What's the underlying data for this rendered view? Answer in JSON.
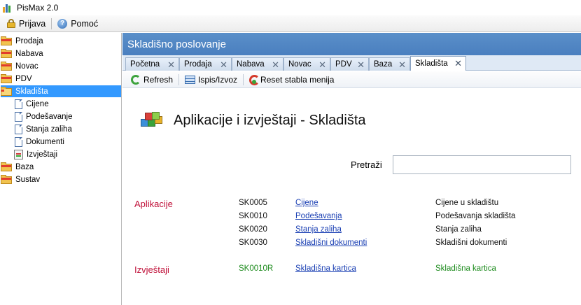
{
  "window": {
    "title": "PisMax 2.0"
  },
  "menubar": {
    "items": [
      {
        "label": "Prijava",
        "icon": "lock-icon"
      },
      {
        "label": "Pomoć",
        "icon": "help-icon"
      }
    ]
  },
  "sidebar": {
    "items": [
      {
        "label": "Prodaja",
        "icon": "folder-icon"
      },
      {
        "label": "Nabava",
        "icon": "folder-icon"
      },
      {
        "label": "Novac",
        "icon": "folder-icon"
      },
      {
        "label": "PDV",
        "icon": "folder-icon"
      },
      {
        "label": "Skladišta",
        "icon": "folder-open-icon",
        "selected": true
      },
      {
        "label": "Cijene",
        "icon": "document-icon"
      },
      {
        "label": "Podešavanje",
        "icon": "document-icon"
      },
      {
        "label": "Stanja zaliha",
        "icon": "document-icon"
      },
      {
        "label": "Dokumenti",
        "icon": "document-icon"
      },
      {
        "label": "Izvještaji",
        "icon": "report-icon"
      },
      {
        "label": "Baza",
        "icon": "folder-icon"
      },
      {
        "label": "Sustav",
        "icon": "folder-icon"
      }
    ]
  },
  "main": {
    "header": "Skladišno poslovanje",
    "tabs": [
      {
        "label": "Početna"
      },
      {
        "label": "Prodaja"
      },
      {
        "label": "Nabava"
      },
      {
        "label": "Novac"
      },
      {
        "label": "PDV"
      },
      {
        "label": "Baza"
      },
      {
        "label": "Skladišta",
        "active": true
      }
    ],
    "close_glyph": "✕"
  },
  "toolbar": {
    "refresh_label": "Refresh",
    "print_label": "Ispis/Izvoz",
    "reset_label": "Reset stabla menija"
  },
  "content": {
    "title": "Aplikacije i izvještaji - Skladišta",
    "search_label": "Pretraži",
    "search_value": "",
    "sections": {
      "applications_label": "Aplikacije",
      "reports_label": "Izvještaji"
    },
    "applications": [
      {
        "code": "SK0005",
        "link": "Cijene",
        "description": "Cijene u skladištu"
      },
      {
        "code": "SK0010",
        "link": "Podešavanja",
        "description": "Podešavanja skladišta"
      },
      {
        "code": "SK0020",
        "link": "Stanja zaliha",
        "description": "Stanja zaliha"
      },
      {
        "code": "SK0030",
        "link": "Skladišni dokumenti",
        "description": "Skladišni dokumenti"
      }
    ],
    "reports": [
      {
        "code": "SK0010R",
        "link": "Skladišna kartica",
        "description": "Skladišna kartica"
      }
    ]
  },
  "colors": {
    "header_blue": "#4a7fbf",
    "selection_blue": "#3399ff",
    "section_red": "#c0123a",
    "report_green": "#1b8a1b",
    "link_blue": "#1a3fb3"
  }
}
